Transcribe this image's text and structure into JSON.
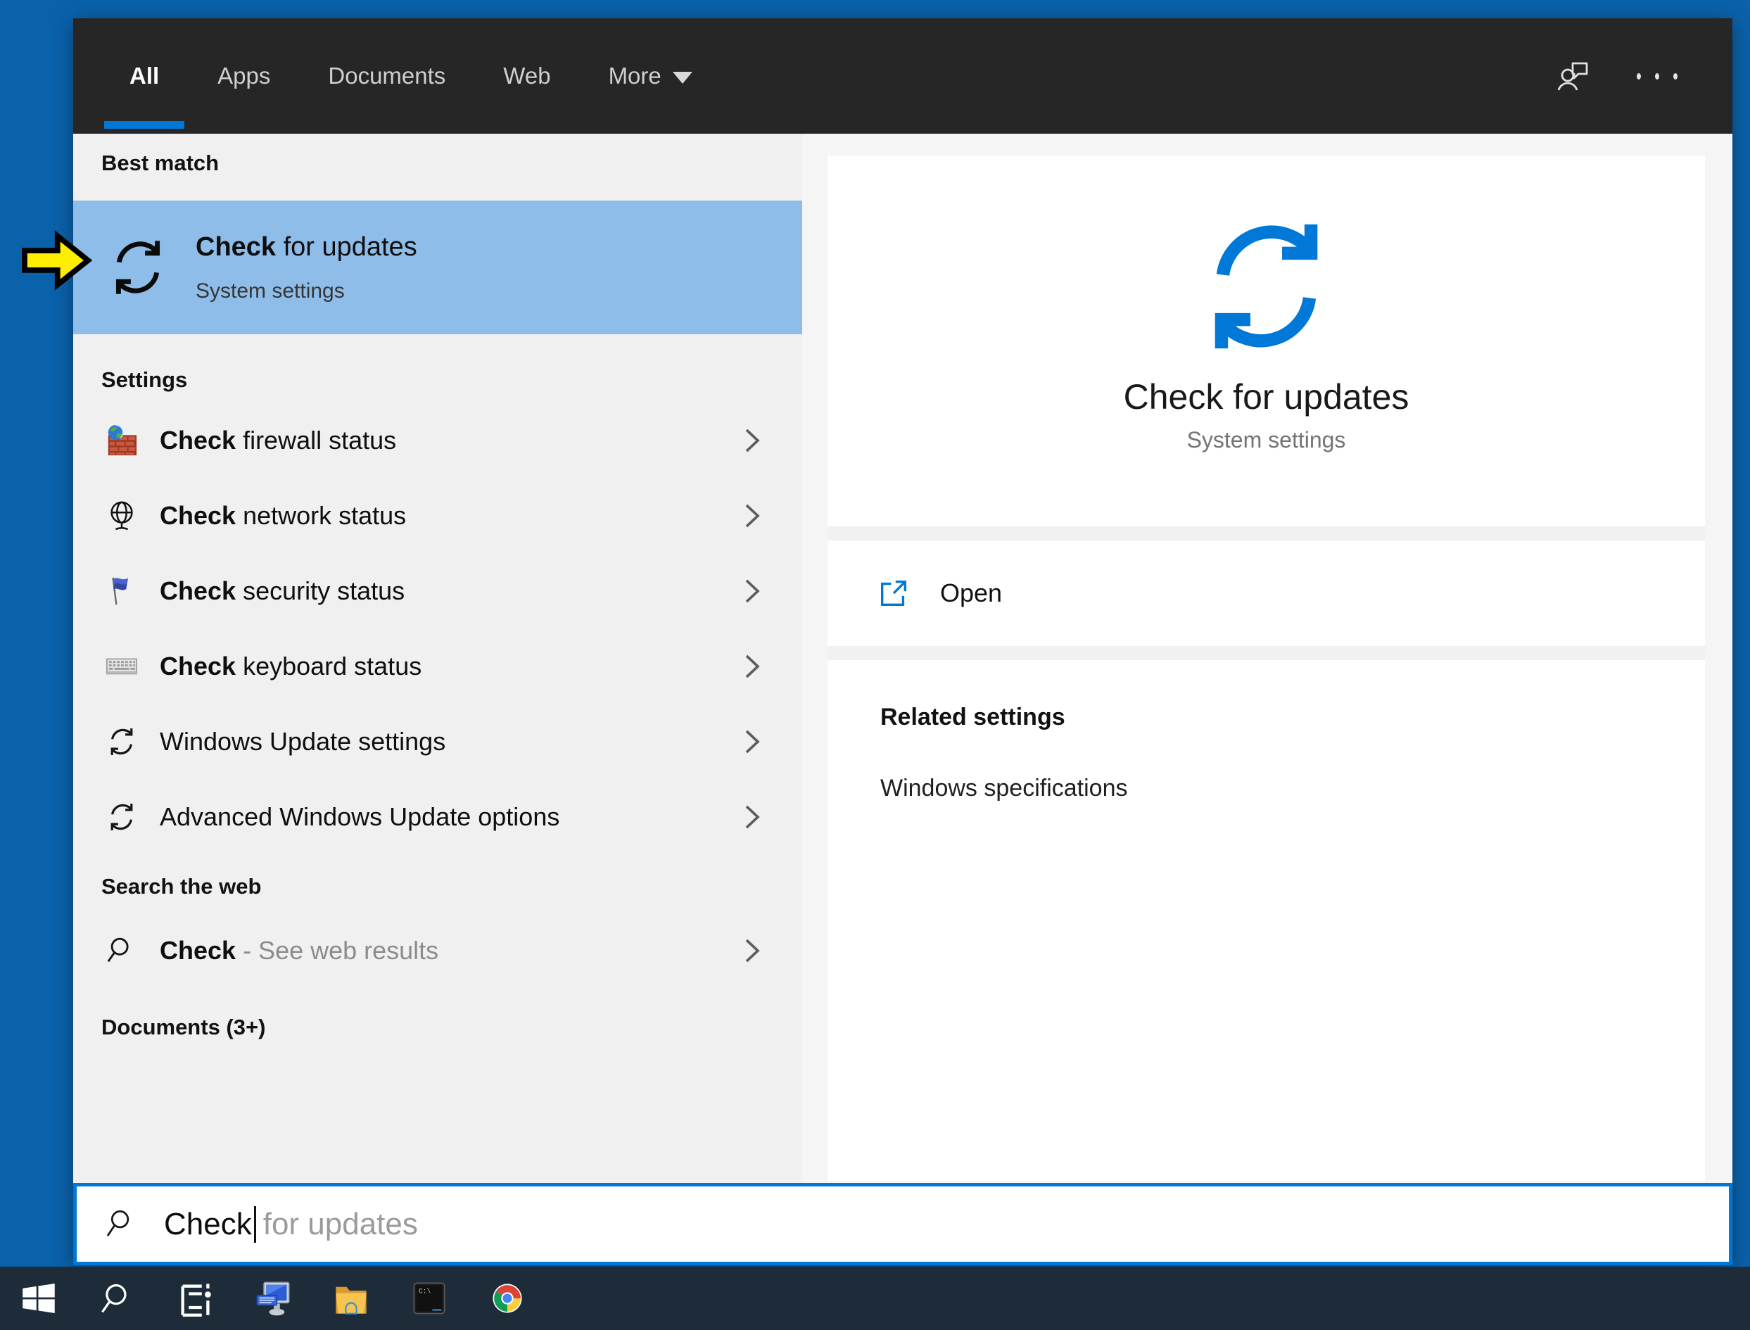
{
  "colors": {
    "desktop": "#0a62ab",
    "header_bg": "#262626",
    "accent": "#0078d7",
    "highlight_row": "#8fbde9",
    "left_panel_bg": "#f0f0f0",
    "taskbar_bg": "#1e2c39",
    "annotation_yellow": "#ffee00"
  },
  "header": {
    "tabs": [
      {
        "label": "All",
        "active": true
      },
      {
        "label": "Apps",
        "active": false
      },
      {
        "label": "Documents",
        "active": false
      },
      {
        "label": "Web",
        "active": false
      },
      {
        "label": "More",
        "active": false
      }
    ],
    "icons": [
      "user-feedback-icon",
      "ellipsis-icon"
    ]
  },
  "left_panel": {
    "best_match_header": "Best match",
    "best_match": {
      "icon": "sync-icon",
      "title_bold": "Check",
      "title_rest": " for updates",
      "subtitle": "System settings"
    },
    "settings_header": "Settings",
    "settings_items": [
      {
        "icon": "firewall-icon",
        "bold": "Check",
        "rest": " firewall status"
      },
      {
        "icon": "network-globe-icon",
        "bold": "Check",
        "rest": " network status"
      },
      {
        "icon": "security-flag-icon",
        "bold": "Check",
        "rest": " security status"
      },
      {
        "icon": "keyboard-icon",
        "bold": "Check",
        "rest": " keyboard status"
      },
      {
        "icon": "sync-icon",
        "bold": "",
        "rest": "Windows Update settings"
      },
      {
        "icon": "sync-icon",
        "bold": "",
        "rest": "Advanced Windows Update options"
      }
    ],
    "search_web_header": "Search the web",
    "web_item": {
      "icon": "search-icon",
      "bold": "Check",
      "rest": " - See web results"
    },
    "documents_header": "Documents (3+)"
  },
  "preview_panel": {
    "icon": "sync-icon",
    "title": "Check for updates",
    "subtitle": "System settings",
    "open_label": "Open",
    "open_icon": "open-external-icon",
    "related_header": "Related settings",
    "related_items": [
      "Windows specifications"
    ]
  },
  "search_box": {
    "icon": "search-icon",
    "typed": "Check",
    "suggestion": "for updates"
  },
  "taskbar": {
    "icons": [
      "windows-start-icon",
      "search-icon",
      "task-view-icon",
      "remote-desktop-icon",
      "file-explorer-icon",
      "command-prompt-icon",
      "chrome-icon"
    ]
  },
  "annotation": {
    "shape": "yellow-arrow-right"
  }
}
